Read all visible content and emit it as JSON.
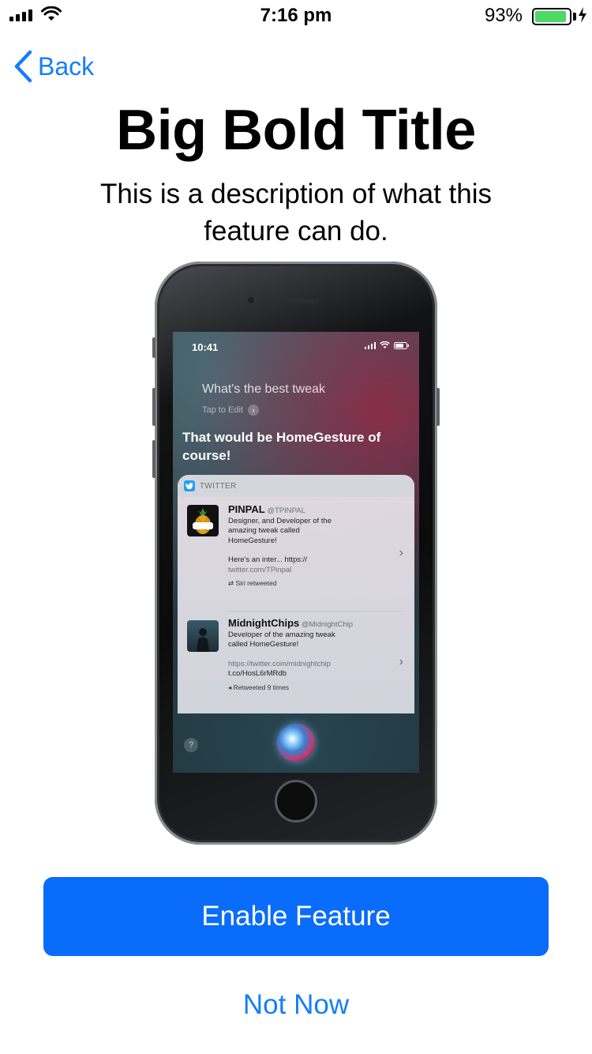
{
  "status_bar": {
    "time": "7:16 pm",
    "battery_percent": "93%",
    "battery_level": 0.93,
    "battery_color": "#4cd964"
  },
  "nav": {
    "back_label": "Back",
    "back_icon": "chevron-left-icon"
  },
  "title": "Big Bold Title",
  "description": "This is a description of what this feature can do.",
  "preview": {
    "time": "10:41",
    "query": "What's the best tweak",
    "tap_to_edit": "Tap to Edit",
    "answer": "That would be HomeGesture of course!",
    "card_source": "TWITTER",
    "tweets": [
      {
        "name": "PINPAL",
        "handle": "@TPINPAL",
        "bio": "Designer, and Developer of the amazing tweak called HomeGesture!",
        "text": "Here's an inter... https://",
        "link": "twitter.com/TPinpal",
        "meta": "Siri retweeted"
      },
      {
        "name": "MidnightChips",
        "handle": "@MidnightChip",
        "bio": "Developer of the amazing tweak called HomeGesture!",
        "link": "https://twitter.com/midnightchip",
        "text": "t.co/HosL6rMRdb",
        "meta": "Retweeted 9 times"
      }
    ],
    "help_label": "?"
  },
  "actions": {
    "enable_label": "Enable Feature",
    "not_now_label": "Not Now"
  },
  "colors": {
    "accent": "#147efb",
    "primary_button": "#0a6cfa"
  }
}
